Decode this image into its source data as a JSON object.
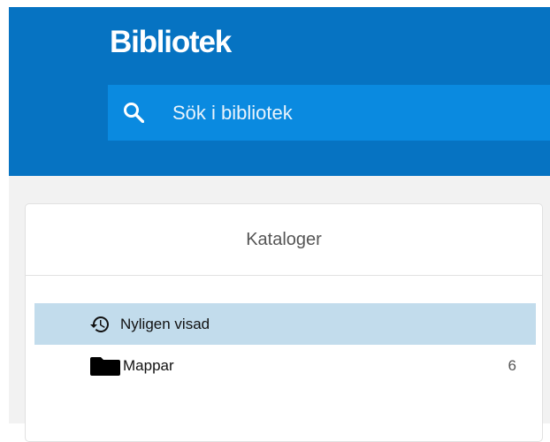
{
  "header": {
    "title": "Bibliotek",
    "color": "#0673c2",
    "search": {
      "icon": "search-icon",
      "placeholder": "Sök i bibliotek",
      "value": ""
    }
  },
  "catalogs": {
    "title": "Kataloger",
    "items": [
      {
        "label": "Nyligen visad",
        "icon": "history-icon",
        "selected": true,
        "count": ""
      },
      {
        "label": "Mappar",
        "icon": "folder-icon",
        "selected": false,
        "count": "6"
      }
    ]
  },
  "colors": {
    "header_bg": "#0673c2",
    "search_bg": "#0a8ae0",
    "selected_row_bg": "#c2dcec",
    "content_bg": "#f2f2f2"
  }
}
